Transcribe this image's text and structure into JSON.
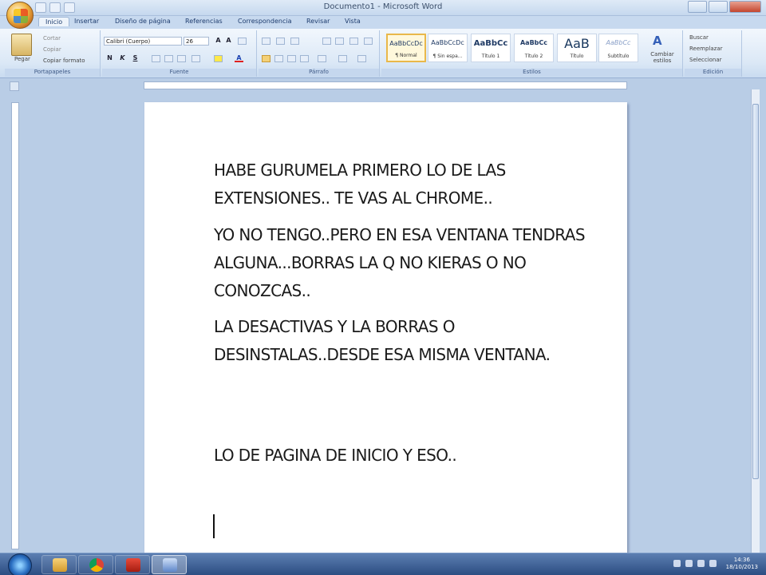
{
  "window": {
    "title": "Documento1 - Microsoft Word"
  },
  "tabs": [
    "Inicio",
    "Insertar",
    "Diseño de página",
    "Referencias",
    "Correspondencia",
    "Revisar",
    "Vista"
  ],
  "ribbon": {
    "clipboard": {
      "paste": "Pegar",
      "cut": "Cortar",
      "copy": "Copiar",
      "format_painter": "Copiar formato",
      "label": "Portapapeles"
    },
    "font": {
      "name": "Calibri (Cuerpo)",
      "size": "26",
      "label": "Fuente"
    },
    "paragraph": {
      "label": "Párrafo"
    },
    "styles": {
      "label": "Estilos",
      "items": [
        {
          "sample": "AaBbCcDc",
          "name": "¶ Normal"
        },
        {
          "sample": "AaBbCcDc",
          "name": "¶ Sin espa..."
        },
        {
          "sample": "AaBbCc",
          "name": "Título 1"
        },
        {
          "sample": "AaBbCc",
          "name": "Título 2"
        },
        {
          "sample": "AaB",
          "name": "Título"
        },
        {
          "sample": "AaBbCc",
          "name": "Subtítulo"
        }
      ],
      "change": "Cambiar estilos"
    },
    "editing": {
      "find": "Buscar",
      "replace": "Reemplazar",
      "select": "Seleccionar",
      "label": "Edición"
    }
  },
  "document": {
    "paragraphs": [
      "HABE GURUMELA PRIMERO LO DE LAS EXTENSIONES.. TE VAS AL CHROME..",
      "YO NO TENGO..PERO EN ESA VENTANA TENDRAS ALGUNA...BORRAS LA Q NO KIERAS O NO CONOZCAS..",
      "LA DESACTIVAS Y LA BORRAS O DESINSTALAS..DESDE ESA MISMA VENTANA.",
      "LO DE PAGINA DE INICIO Y ESO.."
    ]
  },
  "taskbar": {
    "time": "14:36",
    "date": "18/10/2013"
  }
}
